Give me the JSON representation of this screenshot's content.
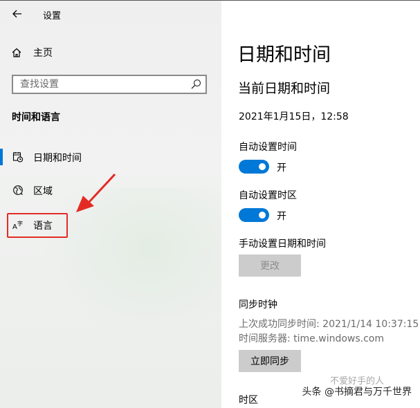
{
  "app": {
    "title": "设置"
  },
  "nav": {
    "home_label": "主页",
    "search_placeholder": "查找设置",
    "section_title": "时间和语言",
    "items": [
      {
        "label": "日期和时间",
        "icon": "calendar-clock-icon",
        "selected": true
      },
      {
        "label": "区域",
        "icon": "globe-icon",
        "selected": false
      },
      {
        "label": "语言",
        "icon": "language-icon",
        "selected": false
      }
    ]
  },
  "main": {
    "page_title": "日期和时间",
    "subtitle": "当前日期和时间",
    "current_datetime": "2021年1月15日，12:58",
    "auto_time": {
      "label": "自动设置时间",
      "state": "开",
      "on": true
    },
    "auto_timezone": {
      "label": "自动设置时区",
      "state": "开",
      "on": true
    },
    "manual": {
      "label": "手动设置日期和时间",
      "button": "更改"
    },
    "sync": {
      "title": "同步时钟",
      "last_sync": "上次成功同步时间: 2021/1/14 10:37:15",
      "server": "时间服务器: time.windows.com",
      "button": "立即同步"
    },
    "timezone_title": "时区"
  },
  "watermark": {
    "text": "头条 @书摘君与万千世界",
    "faint": "不爱好手的人"
  },
  "colors": {
    "accent": "#0078d7",
    "highlight_red": "#e32b24"
  }
}
